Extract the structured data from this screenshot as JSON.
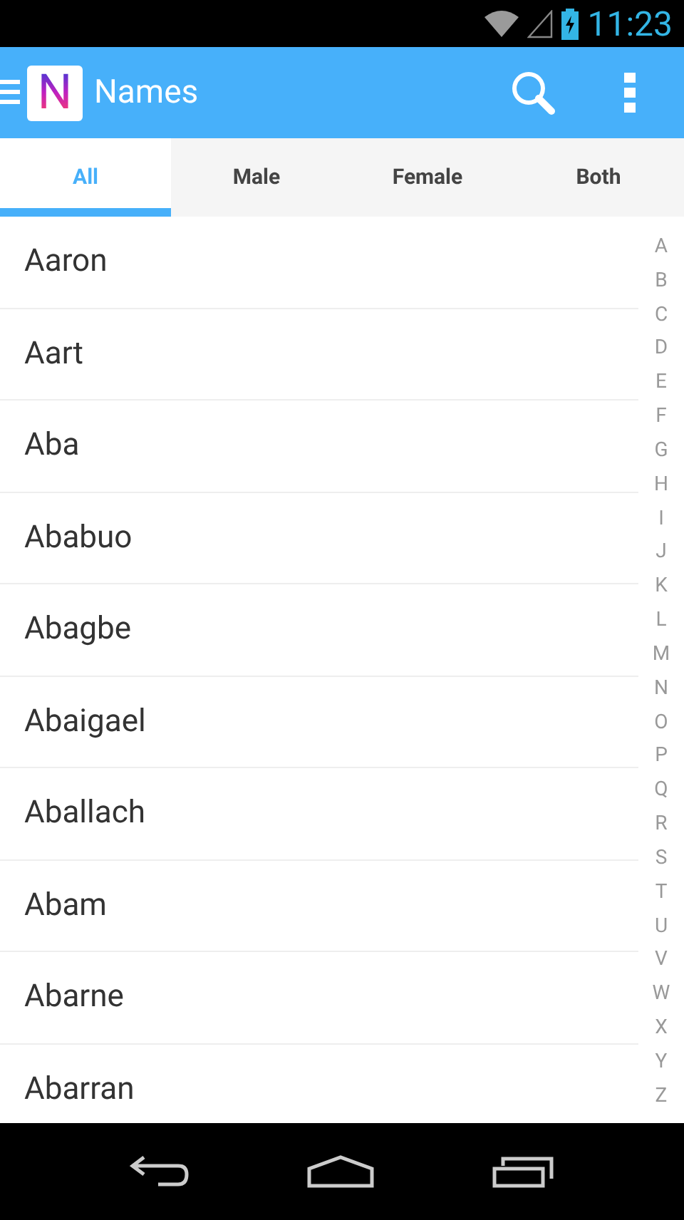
{
  "status_bar": {
    "time": "11:23"
  },
  "app_bar": {
    "logo_letter": "N",
    "title": "Names"
  },
  "tabs": [
    {
      "label": "All",
      "selected": true
    },
    {
      "label": "Male",
      "selected": false
    },
    {
      "label": "Female",
      "selected": false
    },
    {
      "label": "Both",
      "selected": false
    }
  ],
  "names": [
    "Aaron",
    "Aart",
    "Aba",
    "Ababuo",
    "Abagbe",
    "Abaigael",
    "Aballach",
    "Abam",
    "Abarne",
    "Abarran"
  ],
  "index": [
    "A",
    "B",
    "C",
    "D",
    "E",
    "F",
    "G",
    "H",
    "I",
    "J",
    "K",
    "L",
    "M",
    "N",
    "O",
    "P",
    "Q",
    "R",
    "S",
    "T",
    "U",
    "V",
    "W",
    "X",
    "Y",
    "Z"
  ]
}
